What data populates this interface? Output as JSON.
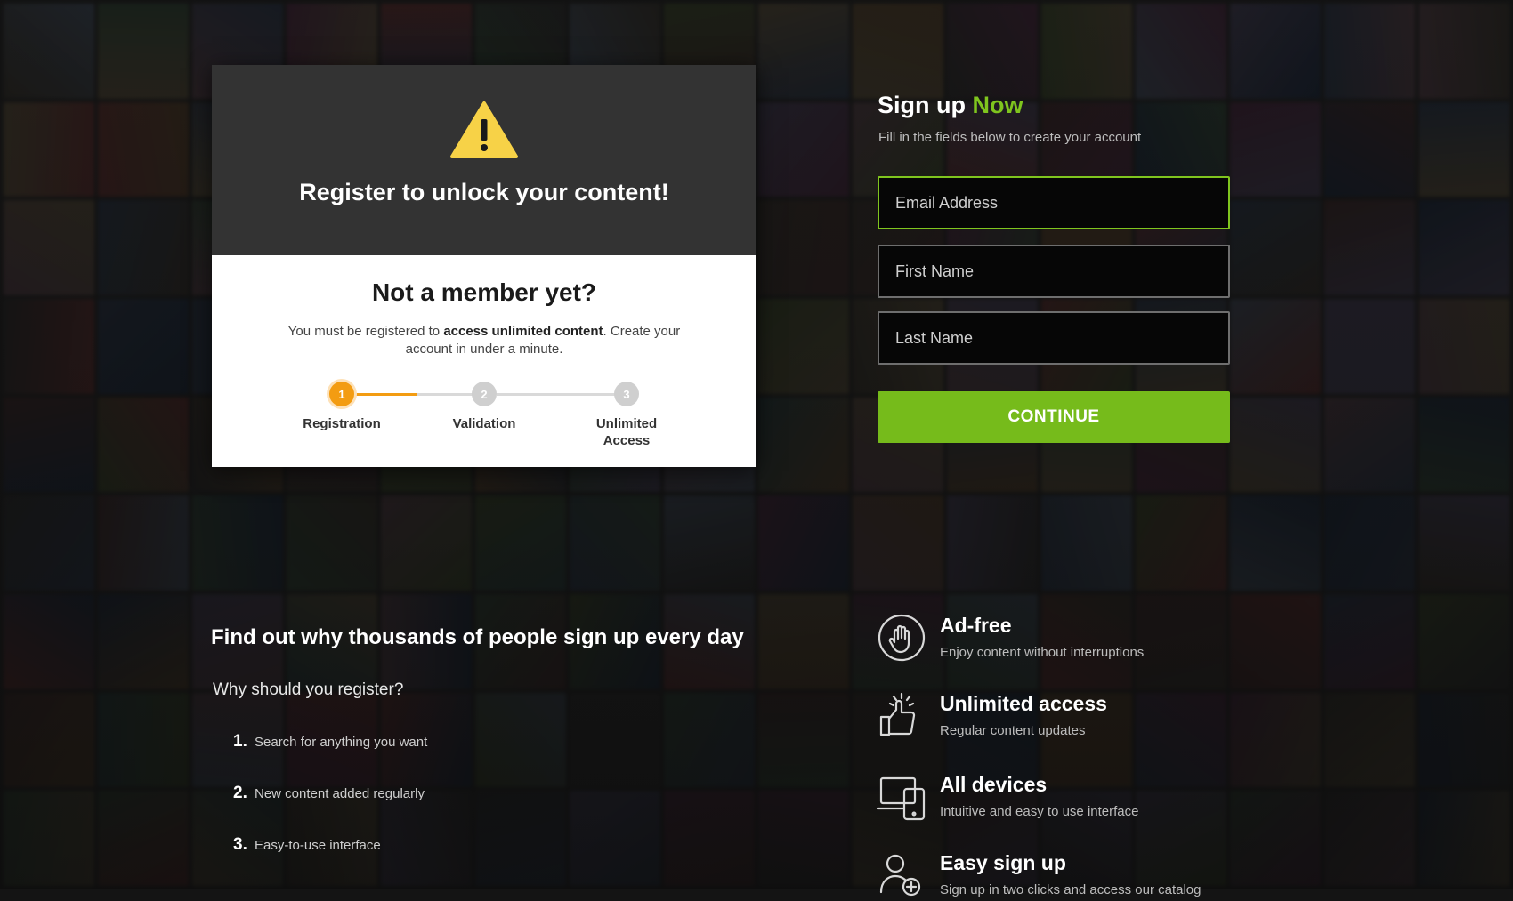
{
  "colors": {
    "accent_green": "#7fc51e",
    "button_green": "#76bb1b",
    "step_orange": "#f39c12",
    "card_dark": "#333333"
  },
  "lock_card": {
    "icon": "warning-triangle-icon",
    "title": "Register to unlock your content!",
    "heading": "Not a member yet?",
    "text_prefix": "You must be registered to ",
    "text_bold": "access unlimited content",
    "text_suffix": ". Create your account in under a minute.",
    "steps": [
      {
        "number": "1",
        "label": "Registration",
        "active": true
      },
      {
        "number": "2",
        "label": "Validation",
        "active": false
      },
      {
        "number": "3",
        "label": "Unlimited Access",
        "active": false
      }
    ]
  },
  "why": {
    "heading": "Find out why thousands of people sign up every day",
    "subheading": "Why should you register?",
    "reasons": [
      {
        "num": "1.",
        "text": "Search for anything you want"
      },
      {
        "num": "2.",
        "text": "New content added regularly"
      },
      {
        "num": "3.",
        "text": "Easy-to-use interface"
      }
    ]
  },
  "signup": {
    "title_main": "Sign up ",
    "title_accent": "Now",
    "subtitle": "Fill in the fields below to create your account",
    "email_placeholder": "Email Address",
    "first_name_placeholder": "First Name",
    "last_name_placeholder": "Last Name",
    "continue_label": "CONTINUE"
  },
  "features": [
    {
      "icon": "hand-icon",
      "title": "Ad-free",
      "desc": "Enjoy content without interruptions"
    },
    {
      "icon": "thumbs-up-icon",
      "title": "Unlimited access",
      "desc": "Regular content updates"
    },
    {
      "icon": "devices-icon",
      "title": "All devices",
      "desc": "Intuitive and easy to use interface"
    },
    {
      "icon": "user-plus-icon",
      "title": "Easy sign up",
      "desc": "Sign up in two clicks and access our catalog"
    }
  ]
}
